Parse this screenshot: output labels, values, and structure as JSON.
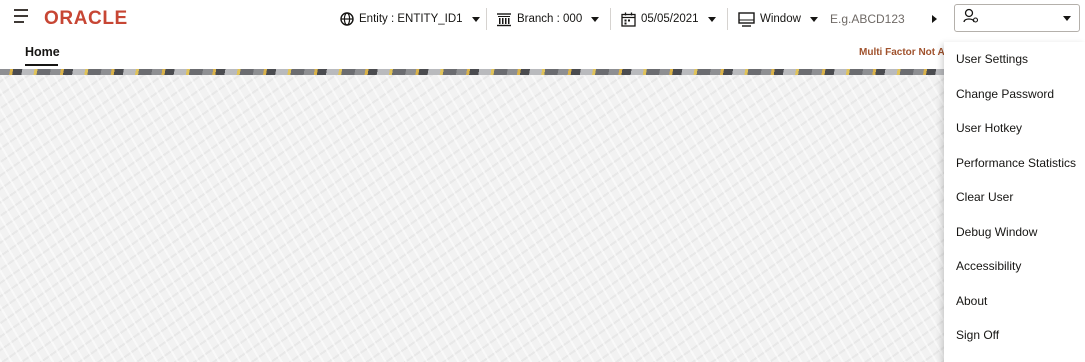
{
  "brand": {
    "logo_text": "ORACLE",
    "color": "#c74634"
  },
  "header": {
    "entity": {
      "label": "Entity : ENTITY_ID1",
      "icon": "globe-icon"
    },
    "branch": {
      "label": "Branch : 000",
      "icon": "bank-icon"
    },
    "date": {
      "label": "05/05/2021",
      "icon": "calendar-icon"
    },
    "window": {
      "label": "Window",
      "icon": "monitor-icon"
    },
    "search": {
      "placeholder": "E.g.ABCD123",
      "value": ""
    },
    "user": {
      "icon": "user-icon"
    }
  },
  "subbar": {
    "tab_home": "Home",
    "mfa_notice": "Multi Factor Not A"
  },
  "user_menu": {
    "items": [
      {
        "label": "User Settings"
      },
      {
        "label": "Change Password"
      },
      {
        "label": "User Hotkey"
      },
      {
        "label": "Performance Statistics"
      },
      {
        "label": "Clear User"
      },
      {
        "label": "Debug Window"
      },
      {
        "label": "Accessibility"
      },
      {
        "label": "About"
      },
      {
        "label": "Sign Off"
      }
    ]
  }
}
